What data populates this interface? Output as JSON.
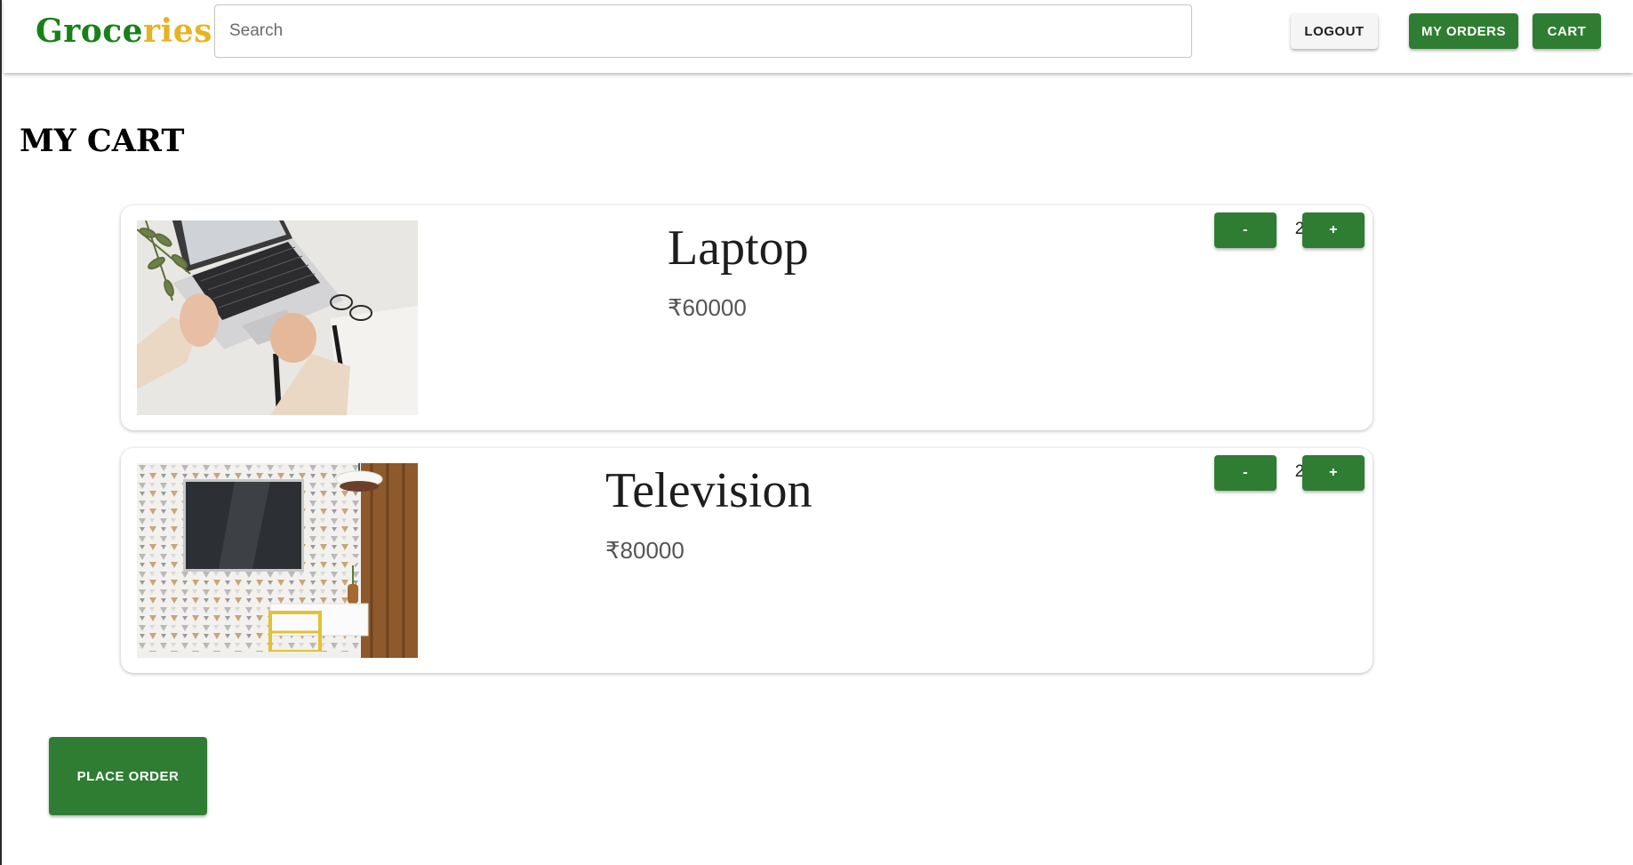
{
  "header": {
    "brand_part1": "Groce",
    "brand_part2": "ries",
    "search_placeholder": "Search",
    "search_value": "",
    "logout_label": "LOGOUT",
    "my_orders_label": "MY ORDERS",
    "cart_label": "CART"
  },
  "main": {
    "title": "MY CART",
    "items": [
      {
        "name": "Laptop",
        "price": "₹60000",
        "quantity": "2",
        "decrement_label": "-",
        "increment_label": "+",
        "image_icon": "laptop-photo-icon"
      },
      {
        "name": "Television",
        "price": "₹80000",
        "quantity": "2",
        "decrement_label": "-",
        "increment_label": "+",
        "image_icon": "television-photo-icon"
      }
    ],
    "place_order_label": "PLACE ORDER"
  },
  "colors": {
    "brand_green": "#188018",
    "brand_yellow": "#e6b422",
    "button_green": "#2e7d32",
    "button_light": "#f5f5f5"
  }
}
